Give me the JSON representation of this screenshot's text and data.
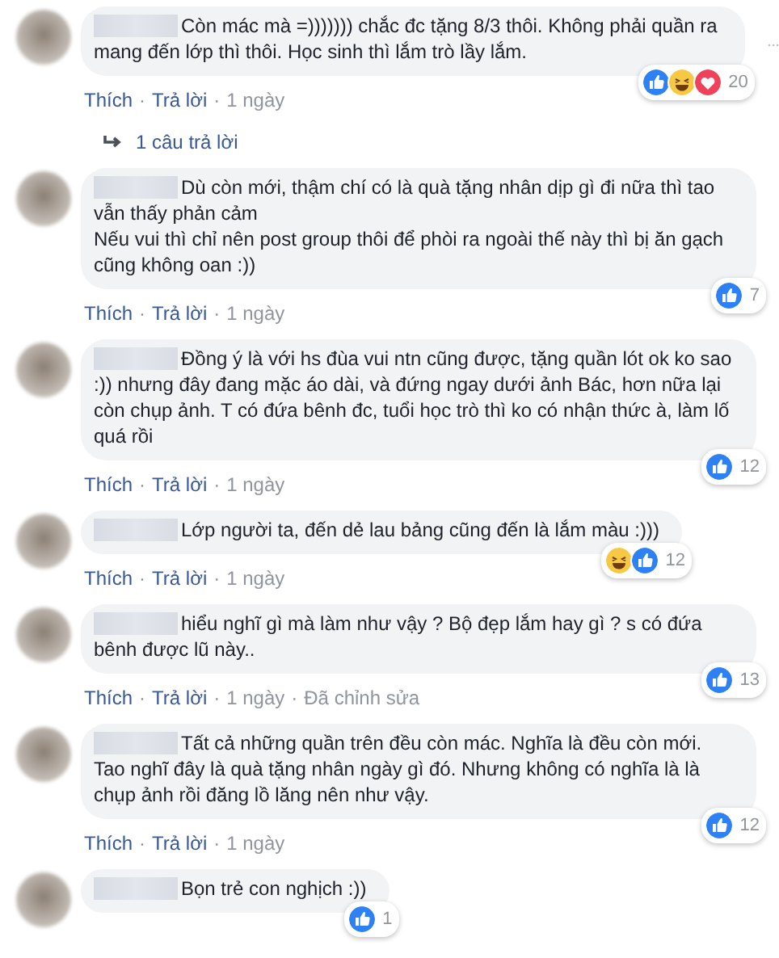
{
  "comments": [
    {
      "text": "Còn mác mà =))))))) chắc đc tặng 8/3 thôi. Không phải quần ra mang đến lớp thì thôi. Học sinh thì lắm trò lầy lắm.",
      "reactions": [
        {
          "kind": "like"
        },
        {
          "kind": "haha"
        },
        {
          "kind": "love"
        }
      ],
      "count": "20",
      "menu": true,
      "meta": [
        {
          "kind": "link",
          "text": "Thích"
        },
        {
          "kind": "sep",
          "text": "·"
        },
        {
          "kind": "link",
          "text": "Trả lời"
        },
        {
          "kind": "sep",
          "text": "·"
        },
        {
          "kind": "time",
          "text": "1 ngày"
        }
      ],
      "replies": "1 câu trả lời"
    },
    {
      "text": "Dù còn mới, thậm chí có là quà tặng nhân dịp gì đi nữa thì tao vẫn thấy phản cảm\nNếu vui thì chỉ nên post group thôi để phòi ra ngoài thế này thì bị ăn gạch cũng không oan :))",
      "reactions": [
        {
          "kind": "like"
        }
      ],
      "count": "7",
      "meta": [
        {
          "kind": "link",
          "text": "Thích"
        },
        {
          "kind": "sep",
          "text": "·"
        },
        {
          "kind": "link",
          "text": "Trả lời"
        },
        {
          "kind": "sep",
          "text": "·"
        },
        {
          "kind": "time",
          "text": "1 ngày"
        }
      ]
    },
    {
      "text": "Đồng ý là với hs đùa vui ntn cũng được, tặng quần lót ok ko sao :)) nhưng đây đang mặc áo dài, và đứng ngay dưới ảnh Bác, hơn nữa lại còn chụp ảnh. T có đứa bênh đc, tuổi học trò thì ko có nhận thức à, làm lố quá rồi",
      "reactions": [
        {
          "kind": "like"
        }
      ],
      "count": "12",
      "meta": [
        {
          "kind": "link",
          "text": "Thích"
        },
        {
          "kind": "sep",
          "text": "·"
        },
        {
          "kind": "link",
          "text": "Trả lời"
        },
        {
          "kind": "sep",
          "text": "·"
        },
        {
          "kind": "time",
          "text": "1 ngày"
        }
      ]
    },
    {
      "text": "Lớp người ta, đến dẻ lau bảng cũng đến là lắm màu :)))",
      "reactions": [
        {
          "kind": "haha"
        },
        {
          "kind": "like"
        }
      ],
      "count": "12",
      "meta": [
        {
          "kind": "link",
          "text": "Thích"
        },
        {
          "kind": "sep",
          "text": "·"
        },
        {
          "kind": "link",
          "text": "Trả lời"
        },
        {
          "kind": "sep",
          "text": "·"
        },
        {
          "kind": "time",
          "text": "1 ngày"
        }
      ]
    },
    {
      "text": "hiểu nghĩ gì mà làm như vậy ? Bộ đẹp lắm hay gì ? s có đứa bênh được lũ này..",
      "reactions": [
        {
          "kind": "like"
        }
      ],
      "count": "13",
      "meta": [
        {
          "kind": "link",
          "text": "Thích"
        },
        {
          "kind": "sep",
          "text": "·"
        },
        {
          "kind": "link",
          "text": "Trả lời"
        },
        {
          "kind": "sep",
          "text": "·"
        },
        {
          "kind": "time",
          "text": "1 ngày"
        },
        {
          "kind": "sep",
          "text": "·"
        },
        {
          "kind": "edited",
          "text": "Đã chỉnh sửa"
        }
      ]
    },
    {
      "text": "Tất cả những quần trên đều còn mác. Nghĩa là đều còn mới. Tao nghĩ đây là quà tặng nhân ngày gì đó. Nhưng không có nghĩa là là chụp ảnh rồi đăng lồ lăng nên như vậy.",
      "reactions": [
        {
          "kind": "like"
        }
      ],
      "count": "12",
      "meta": [
        {
          "kind": "link",
          "text": "Thích"
        },
        {
          "kind": "sep",
          "text": "·"
        },
        {
          "kind": "link",
          "text": "Trả lời"
        },
        {
          "kind": "sep",
          "text": "·"
        },
        {
          "kind": "time",
          "text": "1 ngày"
        }
      ]
    },
    {
      "text": "Bọn trẻ con nghịch :))",
      "reactions": [
        {
          "kind": "like"
        }
      ],
      "count": "1"
    }
  ]
}
